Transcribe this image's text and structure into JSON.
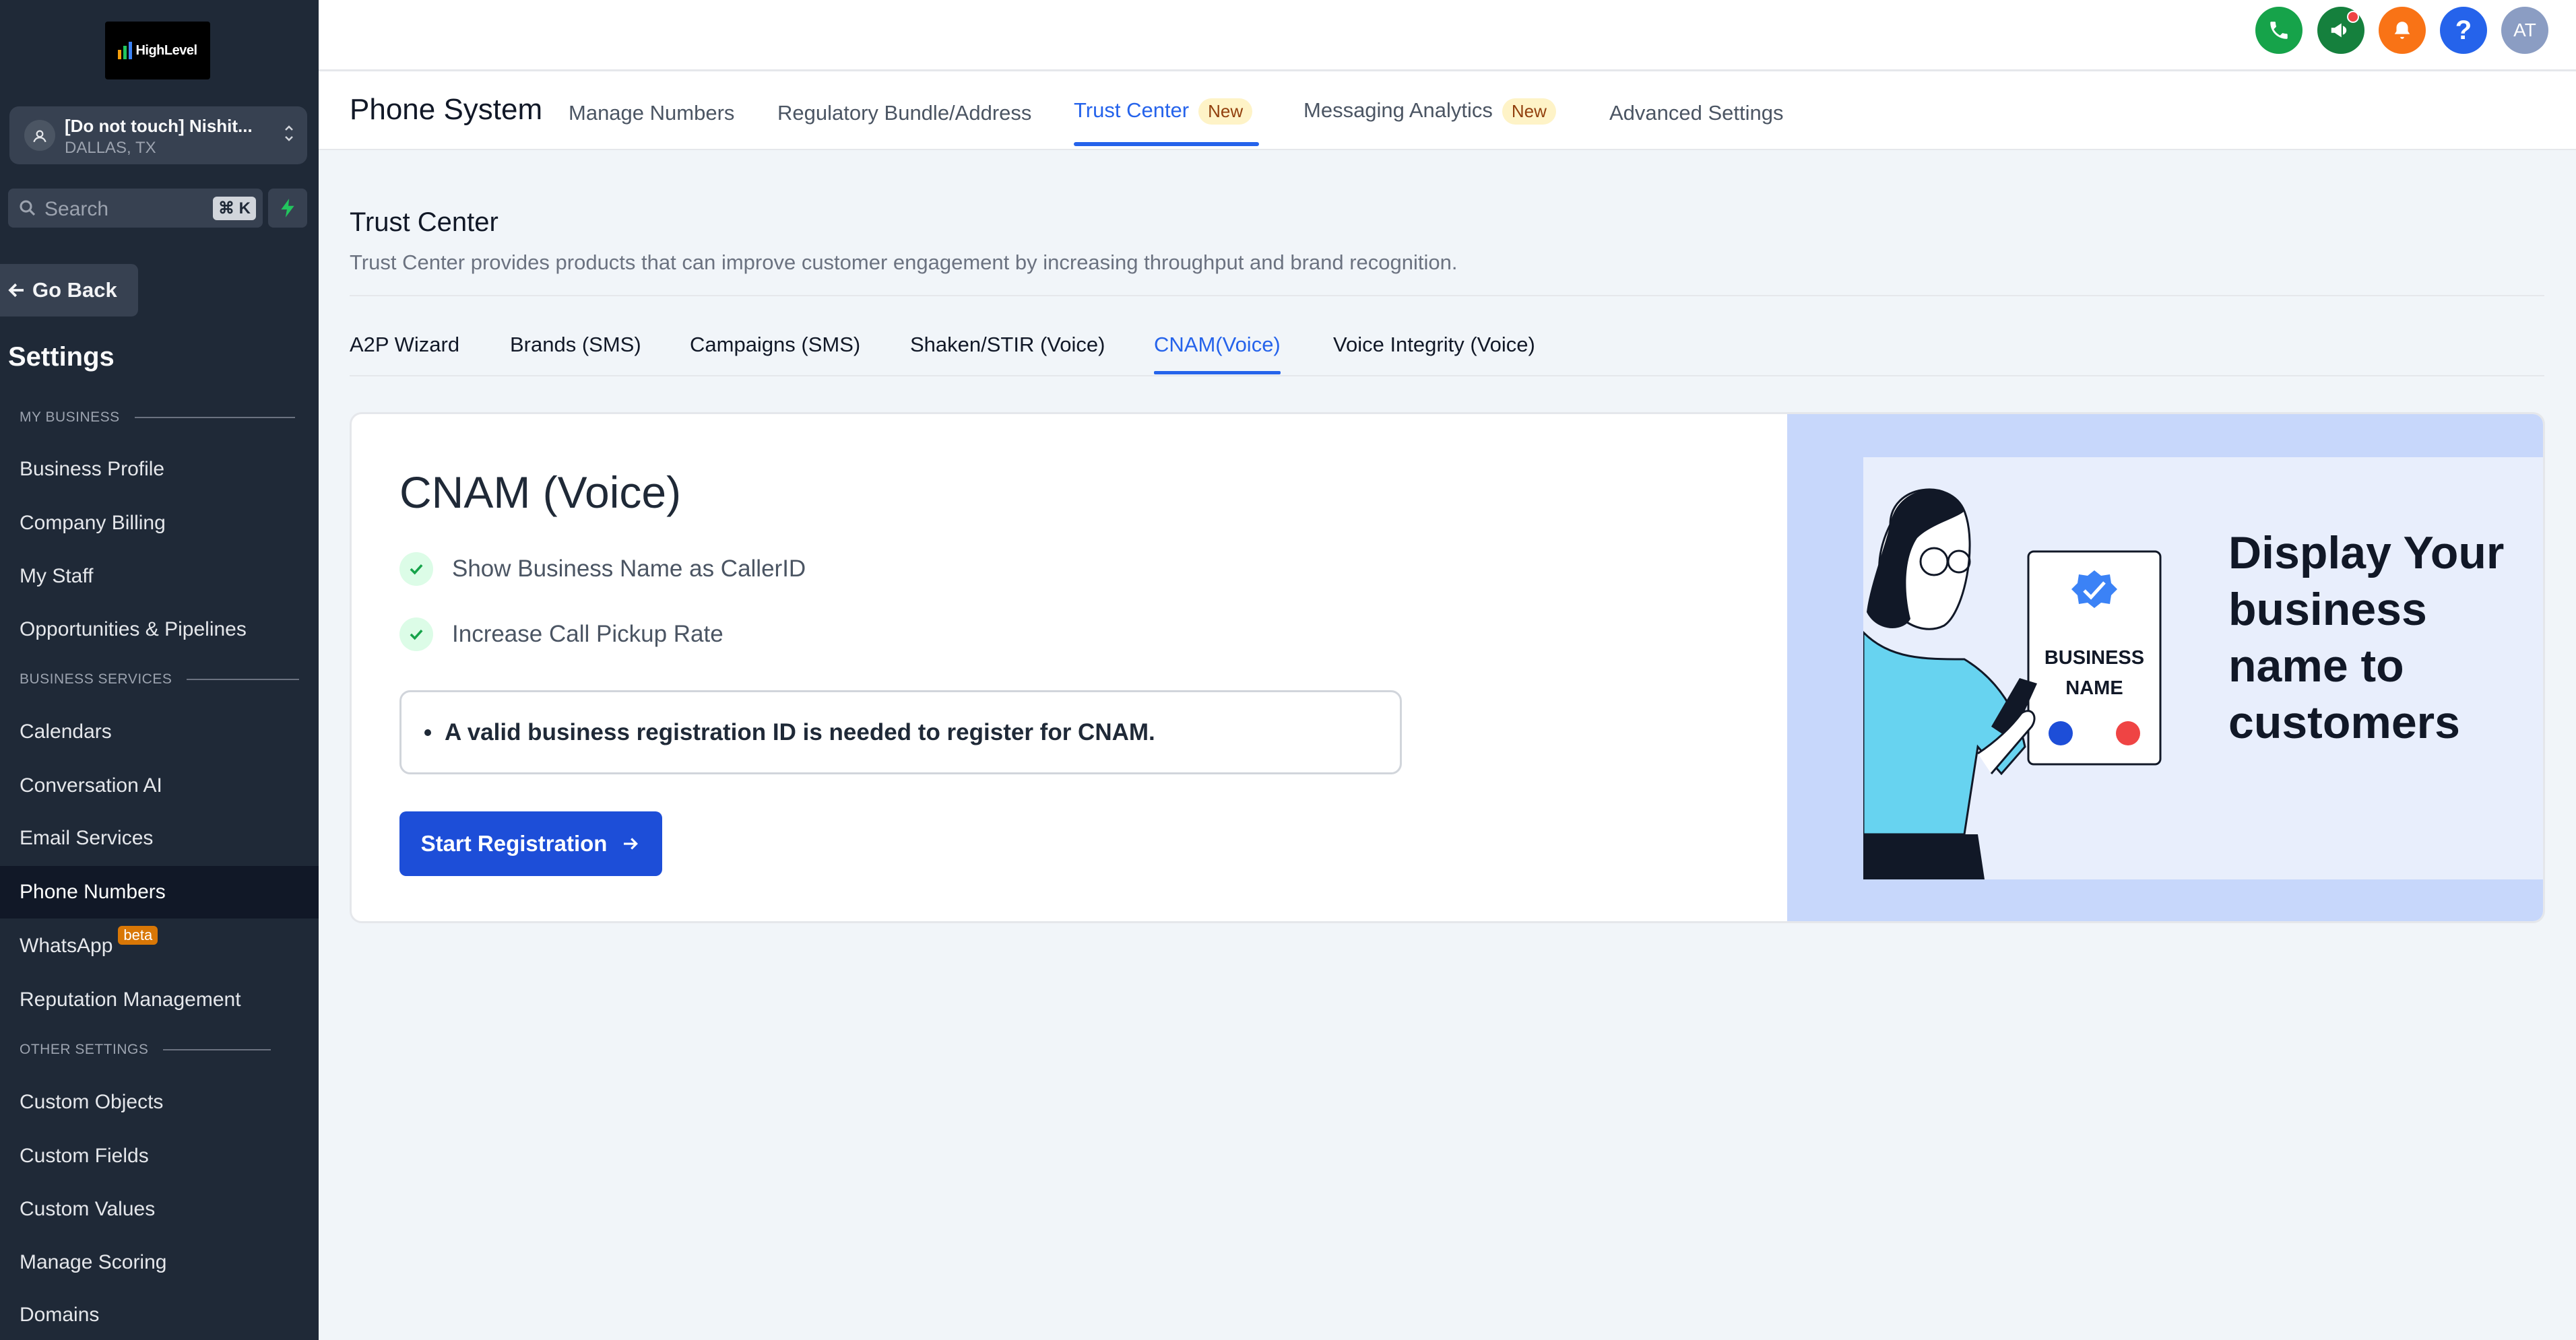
{
  "sidebar": {
    "logo_text": "HighLevel",
    "account": {
      "name": "[Do not touch] Nishit...",
      "location": "DALLAS, TX"
    },
    "search": {
      "placeholder": "Search",
      "shortcut": "⌘ K"
    },
    "go_back": "Go Back",
    "title": "Settings",
    "sections": [
      {
        "label": "MY BUSINESS",
        "items": [
          "Business Profile",
          "Company Billing",
          "My Staff",
          "Opportunities & Pipelines"
        ]
      },
      {
        "label": "BUSINESS SERVICES",
        "items": [
          "Calendars",
          "Conversation AI",
          "Email Services",
          "Phone Numbers",
          "WhatsApp",
          "Reputation Management"
        ]
      },
      {
        "label": "OTHER SETTINGS",
        "items": [
          "Custom Objects",
          "Custom Fields",
          "Custom Values",
          "Manage Scoring",
          "Domains"
        ]
      }
    ],
    "active_item": "Phone Numbers",
    "whatsapp_badge": "beta"
  },
  "topbar": {
    "avatar_initials": "AT"
  },
  "header": {
    "title": "Phone System",
    "tabs": [
      {
        "label": "Manage Numbers",
        "badge": ""
      },
      {
        "label": "Regulatory Bundle/Address",
        "badge": ""
      },
      {
        "label": "Trust Center",
        "badge": "New"
      },
      {
        "label": "Messaging Analytics",
        "badge": "New"
      },
      {
        "label": "Advanced Settings",
        "badge": ""
      }
    ],
    "active_tab": "Trust Center"
  },
  "trust_center": {
    "title": "Trust Center",
    "subtitle": "Trust Center provides products that can improve customer engagement by increasing throughput and brand recognition.",
    "tabs": [
      "A2P Wizard",
      "Brands (SMS)",
      "Campaigns (SMS)",
      "Shaken/STIR (Voice)",
      "CNAM(Voice)",
      "Voice Integrity (Voice)"
    ],
    "active_tab": "CNAM(Voice)"
  },
  "card": {
    "title": "CNAM (Voice)",
    "features": [
      "Show Business Name as CallerID",
      "Increase Call Pickup Rate"
    ],
    "note": "A valid business registration ID is needed to register for CNAM.",
    "button": "Start Registration",
    "promo_text": "Display Your business name to customers",
    "phone_label_1": "BUSINESS",
    "phone_label_2": "NAME"
  },
  "colors": {
    "accent": "#2563eb",
    "sidebar_bg": "#1f2937",
    "button": "#1d4ed8"
  }
}
